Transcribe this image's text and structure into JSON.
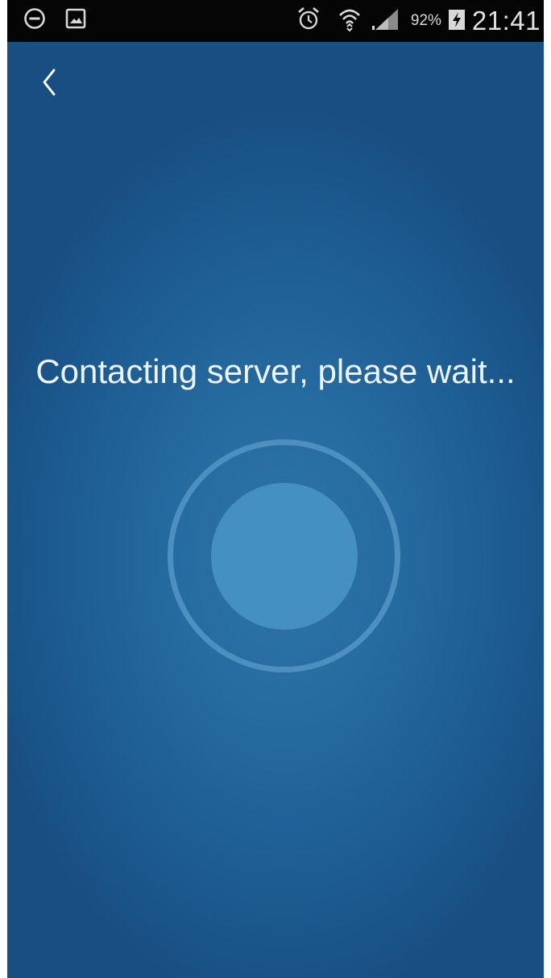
{
  "status_bar": {
    "icons_left": [
      "do-not-disturb-icon",
      "gallery-notification-icon"
    ],
    "icons_right": [
      "alarm-icon",
      "wifi-icon",
      "signal-icon",
      "battery-charging-icon"
    ],
    "battery_percent": "92%",
    "time": "21:41"
  },
  "header": {
    "back_icon": "chevron-left-icon"
  },
  "main": {
    "message": "Contacting server, please wait..."
  },
  "colors": {
    "status_bar_bg": "#050505",
    "background": "#226599",
    "ring": "#4d8fbf",
    "dot": "#4590c2",
    "text": "#eef3f8"
  }
}
